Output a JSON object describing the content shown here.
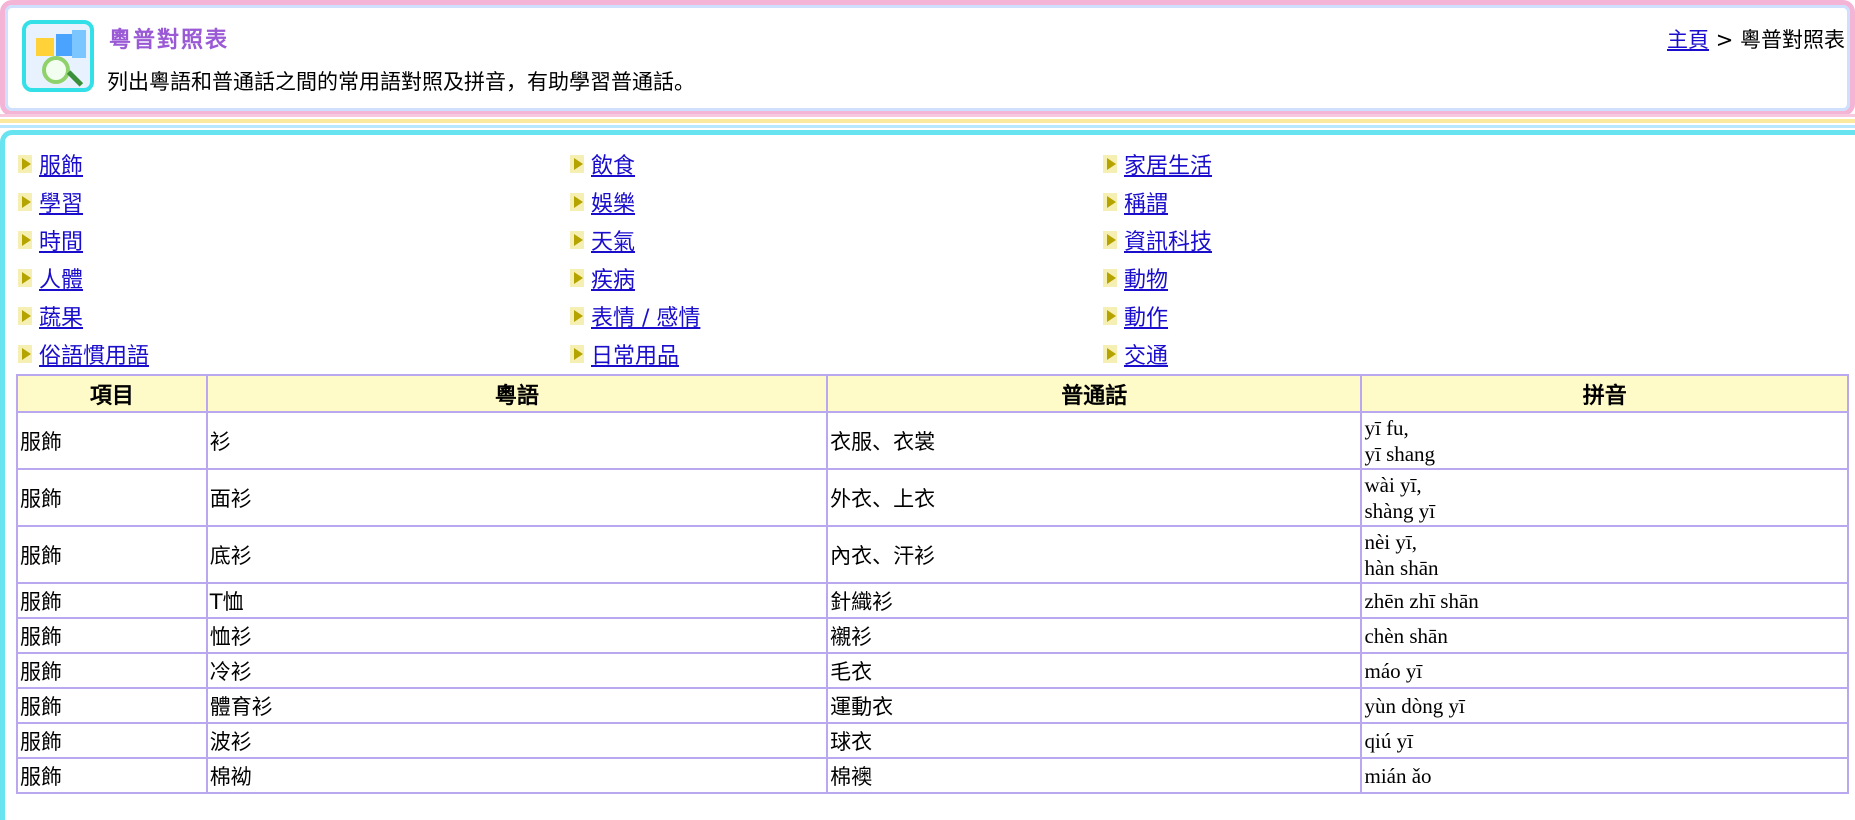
{
  "header": {
    "title": "粵普對照表",
    "description": "列出粵語和普通話之間的常用語對照及拼音，有助學習普通話。",
    "breadcrumb": {
      "home": "主頁",
      "separator": ">",
      "current": "粵普對照表"
    }
  },
  "categories": [
    [
      "服飾",
      "飲食",
      "家居生活"
    ],
    [
      "學習",
      "娛樂",
      "稱謂"
    ],
    [
      "時間",
      "天氣",
      "資訊科技"
    ],
    [
      "人體",
      "疾病",
      "動物"
    ],
    [
      "蔬果",
      "表情 / 感情",
      "動作"
    ],
    [
      "俗語慣用語",
      "日常用品",
      "交通"
    ]
  ],
  "table": {
    "headers": [
      "項目",
      "粵語",
      "普通話",
      "拼音"
    ],
    "rows": [
      {
        "item": "服飾",
        "cantonese": "衫",
        "putonghua": "衣服、衣裳",
        "pinyin": [
          "yī fu,",
          "yī shang"
        ]
      },
      {
        "item": "服飾",
        "cantonese": "面衫",
        "putonghua": "外衣、上衣",
        "pinyin": [
          "wài yī,",
          "shàng yī"
        ]
      },
      {
        "item": "服飾",
        "cantonese": "底衫",
        "putonghua": "內衣、汗衫",
        "pinyin": [
          "nèi yī,",
          "hàn shān"
        ]
      },
      {
        "item": "服飾",
        "cantonese": "T恤",
        "putonghua": "針織衫",
        "pinyin": [
          "zhēn zhī shān"
        ]
      },
      {
        "item": "服飾",
        "cantonese": "恤衫",
        "putonghua": "襯衫",
        "pinyin": [
          "chèn shān"
        ]
      },
      {
        "item": "服飾",
        "cantonese": "冷衫",
        "putonghua": "毛衣",
        "pinyin": [
          "máo yī"
        ]
      },
      {
        "item": "服飾",
        "cantonese": "體育衫",
        "putonghua": "運動衣",
        "pinyin": [
          "yùn dòng yī"
        ]
      },
      {
        "item": "服飾",
        "cantonese": "波衫",
        "putonghua": "球衣",
        "pinyin": [
          "qiú yī"
        ]
      },
      {
        "item": "服飾",
        "cantonese": "棉袎",
        "putonghua": "棉襖",
        "pinyin": [
          "mián ǎo"
        ]
      }
    ]
  },
  "colors": {
    "link": "#1a0dcc",
    "title": "#9a5ad6",
    "header_bg": "#fffbc8",
    "grid": "#b9a8f0"
  }
}
